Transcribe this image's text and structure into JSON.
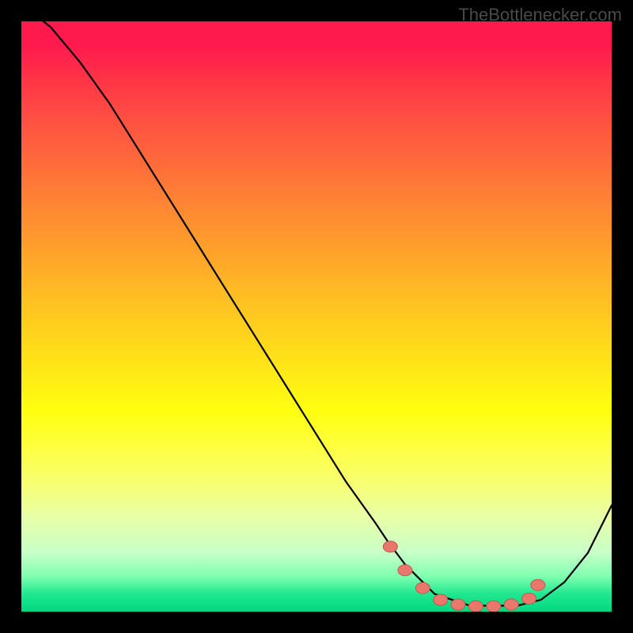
{
  "watermark": "TheBottlenecker.com",
  "chart_data": {
    "type": "line",
    "title": "",
    "xlabel": "",
    "ylabel": "",
    "xlim": [
      0,
      100
    ],
    "ylim": [
      0,
      100
    ],
    "series": [
      {
        "name": "bottleneck-curve",
        "x": [
          0,
          5,
          10,
          15,
          20,
          25,
          30,
          35,
          40,
          45,
          50,
          55,
          60,
          62,
          65,
          68,
          70,
          73,
          76,
          80,
          84,
          88,
          92,
          96,
          100
        ],
        "values": [
          103,
          99,
          93,
          86,
          78,
          70,
          62,
          54,
          46,
          38,
          30,
          22,
          15,
          12,
          8,
          5,
          3,
          2,
          1,
          1,
          1,
          2,
          5,
          10,
          18
        ]
      }
    ],
    "markers": {
      "name": "selected-range",
      "x": [
        62.5,
        65,
        68,
        71,
        74,
        77,
        80,
        83,
        86,
        87.5
      ],
      "values": [
        11,
        7,
        4,
        2,
        1.2,
        0.9,
        0.9,
        1.2,
        2.2,
        4.5
      ]
    },
    "colors": {
      "curve": "#000000",
      "marker_fill": "#e9776b",
      "marker_stroke": "#c05a50",
      "gradient_top": "#ff1a4d",
      "gradient_mid": "#ffe418",
      "gradient_bottom": "#00d880"
    }
  }
}
